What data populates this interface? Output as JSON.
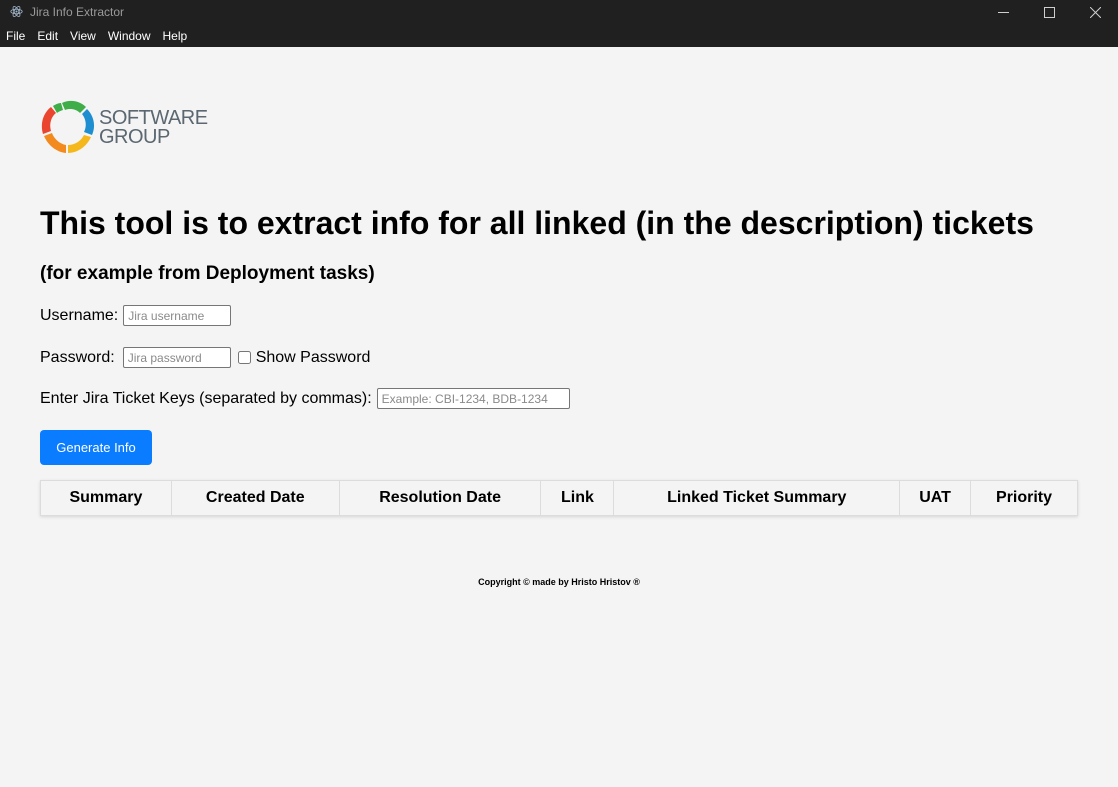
{
  "window": {
    "title": "Jira Info Extractor",
    "icons": {
      "app": "electron-icon",
      "minimize": "minimize-icon",
      "maximize": "maximize-icon",
      "close": "close-icon"
    }
  },
  "menu": {
    "items": [
      "File",
      "Edit",
      "View",
      "Window",
      "Help"
    ]
  },
  "logo": {
    "line1": "SOFTWARE",
    "line2": "GROUP",
    "colors": [
      "#3fae49",
      "#1d8fd1",
      "#f5b81c",
      "#e9452f",
      "#f28a1e"
    ]
  },
  "page": {
    "title": "This tool is to extract info for all linked (in the description) tickets",
    "subtitle": "(for example from Deployment tasks)"
  },
  "form": {
    "username_label": "Username:",
    "username_placeholder": "Jira username",
    "username_value": "",
    "password_label": "Password:",
    "password_placeholder": "Jira password",
    "password_value": "",
    "show_password_label": "Show Password",
    "keys_label": "Enter Jira Ticket Keys (separated by commas):",
    "keys_placeholder": "Example: CBI-1234, BDB-1234",
    "keys_value": "",
    "generate_label": "Generate Info"
  },
  "table": {
    "columns": [
      "Summary",
      "Created Date",
      "Resolution Date",
      "Link",
      "Linked Ticket Summary",
      "UAT",
      "Priority"
    ],
    "rows": []
  },
  "footer": {
    "copyright": "Copyright © made by Hristo Hristov ®"
  },
  "colors": {
    "titlebar": "#202020",
    "accent": "#0a7cff",
    "background": "#f4f4f4"
  }
}
